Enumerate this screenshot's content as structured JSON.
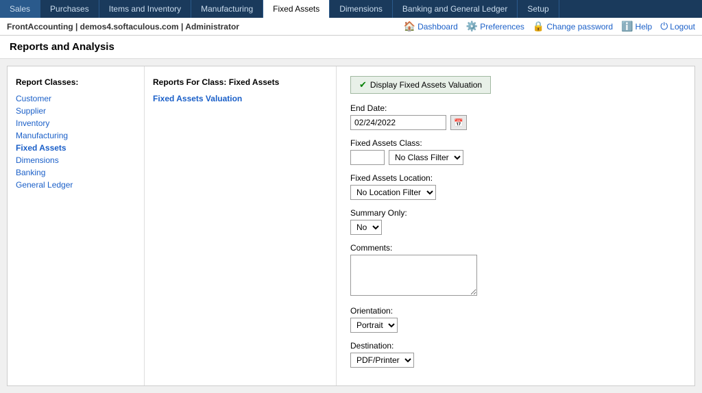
{
  "nav": {
    "tabs": [
      {
        "label": "Sales",
        "active": false
      },
      {
        "label": "Purchases",
        "active": false
      },
      {
        "label": "Items and Inventory",
        "active": false
      },
      {
        "label": "Manufacturing",
        "active": false
      },
      {
        "label": "Fixed Assets",
        "active": true
      },
      {
        "label": "Dimensions",
        "active": false
      },
      {
        "label": "Banking and General Ledger",
        "active": false
      },
      {
        "label": "Setup",
        "active": false
      }
    ]
  },
  "header": {
    "site_info": "FrontAccounting | demos4.softaculous.com | Administrator",
    "actions": [
      {
        "label": "Dashboard",
        "icon": "🏠"
      },
      {
        "label": "Preferences",
        "icon": "⚙️"
      },
      {
        "label": "Change password",
        "icon": "🔒"
      },
      {
        "label": "Help",
        "icon": "ℹ️"
      },
      {
        "label": "Logout",
        "icon": "⏻"
      }
    ]
  },
  "page_title": "Reports and Analysis",
  "sidebar": {
    "heading": "Report Classes:",
    "items": [
      {
        "label": "Customer",
        "active": false
      },
      {
        "label": "Supplier",
        "active": false
      },
      {
        "label": "Inventory",
        "active": false
      },
      {
        "label": "Manufacturing",
        "active": false
      },
      {
        "label": "Fixed Assets",
        "active": true
      },
      {
        "label": "Dimensions",
        "active": false
      },
      {
        "label": "Banking",
        "active": false
      },
      {
        "label": "General Ledger",
        "active": false
      }
    ]
  },
  "reports_section": {
    "heading": "Reports For Class:  Fixed Assets",
    "report_link": "Fixed Assets Valuation"
  },
  "form": {
    "display_btn": "Display  Fixed Assets Valuation",
    "end_date_label": "End Date:",
    "end_date_value": "02/24/2022",
    "fixed_assets_class_label": "Fixed Assets Class:",
    "class_box_value": "",
    "class_select_default": "No Class Filter",
    "fixed_assets_location_label": "Fixed Assets Location:",
    "location_select_default": "No Location Filter",
    "summary_only_label": "Summary Only:",
    "summary_only_default": "No",
    "comments_label": "Comments:",
    "comments_value": "",
    "orientation_label": "Orientation:",
    "orientation_default": "Portrait",
    "destination_label": "Destination:",
    "destination_default": "PDF/Printer"
  }
}
